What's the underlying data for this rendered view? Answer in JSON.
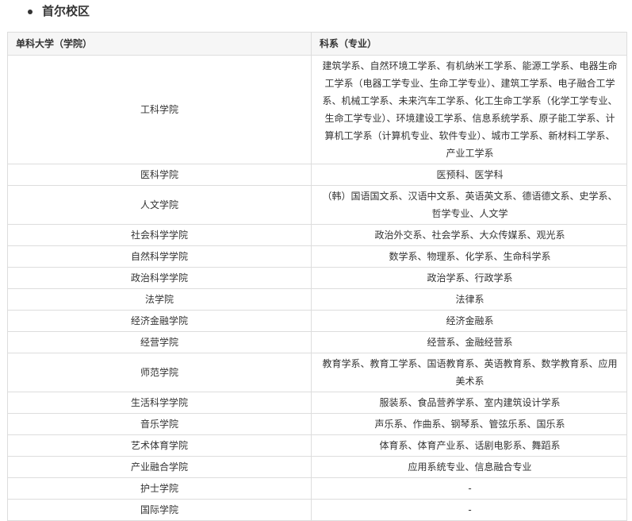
{
  "section": {
    "title": "首尔校区"
  },
  "table": {
    "headers": [
      "单科大学（学院）",
      "科系（专业）"
    ],
    "rows": [
      {
        "college": "工科学院",
        "depts": "建筑学系、自然环境工学系、有机纳米工学系、能源工学系、电器生命工学系（电器工学专业、生命工学专业）、建筑工学系、电子融合工学系、机械工学系、未来汽车工学系、化工生命工学系（化学工学专业、生命工学专业）、环境建设工学系、信息系统学系、原子能工学系、计算机工学系（计算机专业、软件专业）、城市工学系、新材料工学系、产业工学系"
      },
      {
        "college": "医科学院",
        "depts": "医预科、医学科"
      },
      {
        "college": "人文学院",
        "depts": "（韩）国语国文系、汉语中文系、英语英文系、德语德文系、史学系、哲学专业、人文学"
      },
      {
        "college": "社会科学学院",
        "depts": "政治外交系、社会学系、大众传媒系、观光系"
      },
      {
        "college": "自然科学学院",
        "depts": "数学系、物理系、化学系、生命科学系"
      },
      {
        "college": "政治科学学院",
        "depts": "政治学系、行政学系"
      },
      {
        "college": "法学院",
        "depts": "法律系"
      },
      {
        "college": "经济金融学院",
        "depts": "经济金融系"
      },
      {
        "college": "经营学院",
        "depts": "经营系、金融经营系"
      },
      {
        "college": "师范学院",
        "depts": "教育学系、教育工学系、国语教育系、英语教育系、数学教育系、应用美术系"
      },
      {
        "college": "生活科学学院",
        "depts": "服装系、食品营养学系、室内建筑设计学系"
      },
      {
        "college": "音乐学院",
        "depts": "声乐系、作曲系、钢琴系、管弦乐系、国乐系"
      },
      {
        "college": "艺术体育学院",
        "depts": "体育系、体育产业系、话剧电影系、舞蹈系"
      },
      {
        "college": "产业融合学院",
        "depts": "应用系统专业、信息融合专业"
      },
      {
        "college": "护士学院",
        "depts": "-"
      },
      {
        "college": "国际学院",
        "depts": "-"
      }
    ]
  }
}
